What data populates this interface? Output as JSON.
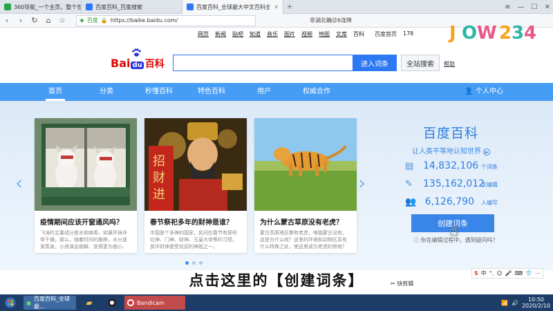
{
  "browser": {
    "tabs": [
      {
        "label": "360导航_一个主页，整个世界",
        "active": false,
        "color": "#2aa44a"
      },
      {
        "label": "百度百科_百度搜索",
        "active": false,
        "color": "#2d78f4"
      },
      {
        "label": "百度百科_全球最大中文百科全书",
        "active": true,
        "color": "#2d78f4"
      }
    ],
    "site_name": "百度",
    "url": "https://baike.baidu.com/",
    "hot_search": "非湖北确诊6连降"
  },
  "top_links": [
    "网页",
    "新闻",
    "贴吧",
    "知道",
    "音乐",
    "图片",
    "视频",
    "地图",
    "文库",
    "百科"
  ],
  "top_home": "百度首页",
  "top_extra": "178",
  "search": {
    "button": "进入词条",
    "all_button": "全站搜索",
    "help": "帮助"
  },
  "logo": {
    "bai": "Bai",
    "du": "du",
    "bk": "百科"
  },
  "nav": {
    "items": [
      "首页",
      "分类",
      "秒懂百科",
      "特色百科",
      "用户",
      "权威合作"
    ],
    "personal": "个人中心"
  },
  "cards": [
    {
      "title": "疫情期间应该开窗通风吗？",
      "desc": "飞沫的主要成分是水和病毒，如果环境非常干燥，那么，随着时间的推移，水分逐渐蒸发，小液滴会崩解，变得更为细小。"
    },
    {
      "title": "春节祭祀多年的财神是谁？",
      "desc": "中国是个多神的国家，民间在春节有祭祀灶神、门神、财神、玉皇大帝等的习惯。其中财神是受欢迎的神祇之一。"
    },
    {
      "title": "为什么蒙古草原没有老虎？",
      "desc": "蒙古高原地区都有老虎，唯独蒙古没有，这是为什么呢？这里的环境和动物区系有什么特殊之处，使这里成为老虎的禁地？"
    }
  ],
  "stats": {
    "title": "百度百科",
    "slogan": "让人类平等地认知世界",
    "entries_num": "14,832,106",
    "entries_unit": "个词条",
    "edits_num": "135,162,012",
    "edits_unit": "次编辑",
    "editors_num": "6,126,790",
    "editors_unit": "人编写",
    "create_button": "创建词条",
    "help_text": "你在编辑过程中，遇到疑问吗？"
  },
  "caption": "点击这里的【创建词条】",
  "quick_link": "快剪辑",
  "ime": [
    "S",
    "中",
    "°,",
    "☺",
    "🎤",
    "⌨",
    "👕",
    "⋯"
  ],
  "taskbar": {
    "browser_label": "百度百科_全球最...",
    "bandicam_label": "Bandicam",
    "time": "10:50",
    "date": "2020/2/10"
  },
  "colors": {
    "accent": "#459df5",
    "brand_red": "#e10602",
    "brand_blue": "#2932e1"
  }
}
